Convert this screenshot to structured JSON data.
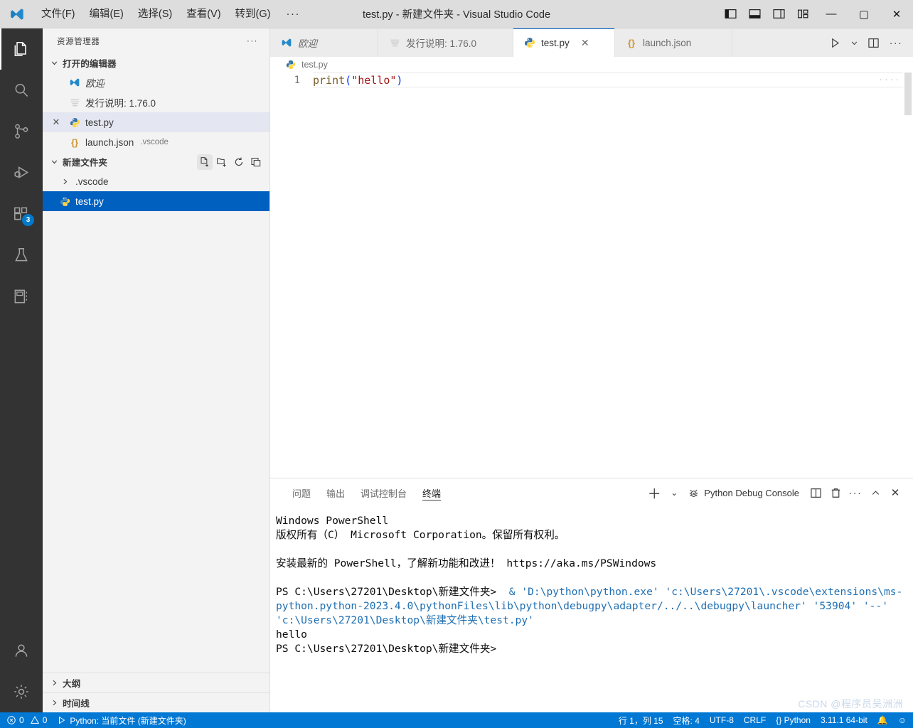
{
  "window": {
    "title": "test.py - 新建文件夹 - Visual Studio Code",
    "menus": [
      "文件(F)",
      "编辑(E)",
      "选择(S)",
      "查看(V)",
      "转到(G)"
    ],
    "more": "···",
    "layout_buttons": [
      "toggle-primary-sidebar",
      "toggle-panel",
      "toggle-secondary-sidebar",
      "customize-layout"
    ],
    "minimize": "—",
    "maximize": "▢",
    "close": "✕"
  },
  "activity_bar": {
    "items": [
      {
        "name": "explorer",
        "icon": "files-icon",
        "active": true,
        "badge": ""
      },
      {
        "name": "search",
        "icon": "search-icon",
        "active": false,
        "badge": ""
      },
      {
        "name": "source-control",
        "icon": "source-control-icon",
        "active": false,
        "badge": ""
      },
      {
        "name": "run-and-debug",
        "icon": "run-debug-icon",
        "active": false,
        "badge": ""
      },
      {
        "name": "extensions",
        "icon": "extensions-icon",
        "active": false,
        "badge": "3"
      },
      {
        "name": "testing",
        "icon": "beaker-icon",
        "active": false,
        "badge": ""
      },
      {
        "name": "notebook",
        "icon": "notebook-icon",
        "active": false,
        "badge": ""
      }
    ],
    "bottom": [
      {
        "name": "accounts",
        "icon": "account-icon"
      },
      {
        "name": "manage",
        "icon": "gear-icon"
      }
    ]
  },
  "sidebar": {
    "header": "资源管理器",
    "header_more": "···",
    "open_editors": {
      "label": "打开的编辑器",
      "chevron": "▾",
      "items": [
        {
          "name": "welcome",
          "icon": "vscode-icon",
          "label": "欧迎",
          "desc": "",
          "state": "none",
          "italic": true
        },
        {
          "name": "release-notes",
          "icon": "release-notes-icon",
          "label": "发行说明: 1.76.0",
          "desc": "",
          "state": "none",
          "italic": false
        },
        {
          "name": "test-py",
          "icon": "python-icon",
          "label": "test.py",
          "desc": "",
          "state": "soft",
          "italic": false,
          "closable": true
        },
        {
          "name": "launch-json",
          "icon": "json-icon",
          "label": "launch.json",
          "desc": ".vscode",
          "state": "none",
          "italic": false
        }
      ]
    },
    "folder": {
      "label": "新建文件夹",
      "chevron": "▾",
      "actions": [
        "new-file-icon",
        "new-folder-icon",
        "refresh-icon",
        "collapse-all-icon"
      ],
      "items": [
        {
          "name": "vscode-folder",
          "icon": "folder-chevron-icon",
          "label": ".vscode",
          "state": "none",
          "chevron": "›"
        },
        {
          "name": "test-py-file",
          "icon": "python-icon",
          "label": "test.py",
          "state": "strong",
          "chevron": ""
        }
      ]
    },
    "bottom_sections": [
      {
        "name": "outline",
        "label": "大纲",
        "chevron": "›"
      },
      {
        "name": "timeline",
        "label": "时间线",
        "chevron": "›"
      }
    ]
  },
  "editor": {
    "tabs": [
      {
        "name": "tab-welcome",
        "icon": "vscode-icon",
        "label": "欧迎",
        "active": false,
        "italic": true,
        "closable": false
      },
      {
        "name": "tab-release-notes",
        "icon": "release-notes-icon",
        "label": "发行说明: 1.76.0",
        "active": false,
        "italic": false,
        "closable": false
      },
      {
        "name": "tab-test-py",
        "icon": "python-icon",
        "label": "test.py",
        "active": true,
        "italic": false,
        "closable": true,
        "close": "✕"
      },
      {
        "name": "tab-launch-json",
        "icon": "json-icon",
        "label": "launch.json",
        "active": false,
        "italic": false,
        "closable": false
      }
    ],
    "actions": [
      "run-python-file-icon",
      "chevron-down-icon",
      "split-editor-icon",
      "more-actions-icon"
    ],
    "breadcrumb": {
      "icon": "python-icon",
      "label": "test.py"
    },
    "line_number": "1",
    "code": {
      "fn": "print",
      "open_paren": "(",
      "string": "\"hello\"",
      "close_paren": ")"
    }
  },
  "panel": {
    "tabs": [
      {
        "name": "tab-problems",
        "label": "问题",
        "active": false
      },
      {
        "name": "tab-output",
        "label": "输出",
        "active": false
      },
      {
        "name": "tab-debug-console",
        "label": "调试控制台",
        "active": false
      },
      {
        "name": "tab-terminal",
        "label": "终端",
        "active": true
      }
    ],
    "actions": {
      "new_terminal": "＋",
      "new_terminal_dropdown": "⌄",
      "terminal_name": "Python Debug Console",
      "terminal_icon": "debug-console-icon",
      "split": "split-terminal-icon",
      "kill": "trash-icon",
      "views_and_more": "···",
      "maximize": "⌃",
      "close": "✕"
    },
    "terminal_lines": [
      {
        "segments": [
          {
            "t": "Windows PowerShell",
            "c": "plain"
          }
        ]
      },
      {
        "segments": [
          {
            "t": "版权所有（C） Microsoft Corporation。保留所有权利。",
            "c": "plain"
          }
        ]
      },
      {
        "segments": [
          {
            "t": "",
            "c": "plain"
          }
        ]
      },
      {
        "segments": [
          {
            "t": "安装最新的 PowerShell，了解新功能和改进！ https://aka.ms/PSWindows",
            "c": "plain"
          }
        ]
      },
      {
        "segments": [
          {
            "t": "",
            "c": "plain"
          }
        ]
      },
      {
        "segments": [
          {
            "t": "PS C:\\Users\\27201\\Desktop\\新建文件夹> ",
            "c": "plain"
          },
          {
            "t": " & 'D:\\python\\python.exe' 'c:\\Users\\27201\\.vscode\\extensions\\ms-python.python-2023.4.0\\pythonFiles\\lib\\python\\debugpy\\adapter/../..\\debugpy\\launcher' '53904' '--' 'c:\\Users\\27201\\Desktop\\新建文件夹\\test.py'",
            "c": "blue"
          }
        ]
      },
      {
        "segments": [
          {
            "t": "hello",
            "c": "plain"
          }
        ]
      },
      {
        "segments": [
          {
            "t": "PS C:\\Users\\27201\\Desktop\\新建文件夹>",
            "c": "plain"
          }
        ]
      }
    ]
  },
  "status_bar": {
    "left": [
      {
        "name": "problems-status",
        "icon": "error-icon",
        "text": "0",
        "icon2": "warning-icon",
        "text2": "0"
      },
      {
        "name": "python-interpreter-status",
        "icon": "run-icon",
        "text": "Python: 当前文件 (新建文件夹)"
      }
    ],
    "right": [
      {
        "name": "cursor-position",
        "text": "行 1，列 15"
      },
      {
        "name": "indentation",
        "text": "空格: 4"
      },
      {
        "name": "encoding",
        "text": "UTF-8"
      },
      {
        "name": "eol",
        "text": "CRLF"
      },
      {
        "name": "language-mode",
        "text": "{} Python"
      },
      {
        "name": "python-version",
        "text": "3.11.1 64-bit"
      },
      {
        "name": "notifications",
        "text": "🔔"
      },
      {
        "name": "feedback",
        "text": "☺"
      }
    ]
  },
  "watermark": "CSDN @程序员吴洲洲",
  "colors": {
    "accent": "#0078d4",
    "selection": "#0060c0",
    "activitybar_bg": "#333333",
    "sidebar_bg": "#f3f3f3",
    "titlebar_bg": "#dddddd",
    "terminal_blue": "#1f6fb2"
  }
}
